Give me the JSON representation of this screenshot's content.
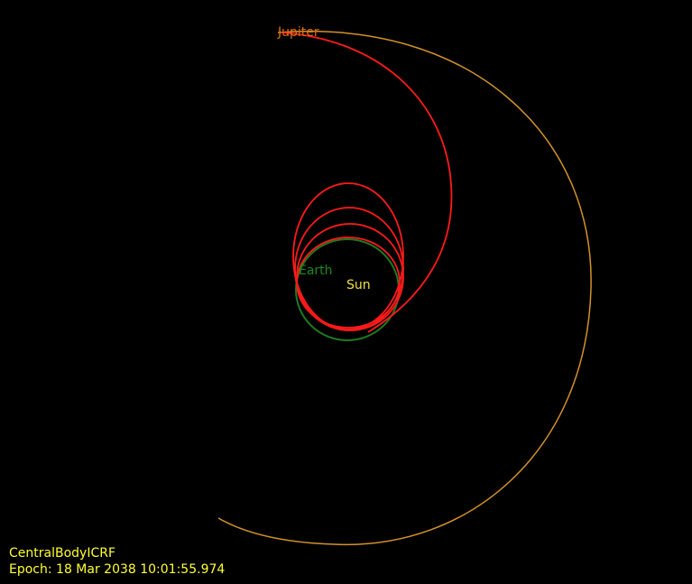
{
  "scene": {
    "background": "#000000",
    "bodies": {
      "jupiter": {
        "label": "Jupiter",
        "color": "#e07010"
      },
      "earth": {
        "label": "Earth",
        "color": "#1a8a1a"
      },
      "sun": {
        "label": "Sun",
        "color": "#f0e040"
      }
    },
    "orbits": {
      "jupiter_color": "#d4922a",
      "earth_color": "#1f7a1f",
      "spacecraft_color": "#ff1a1a"
    }
  },
  "overlay": {
    "frame": "CentralBodyICRF",
    "epoch": "Epoch: 18 Mar 2038 10:01:55.974",
    "color": "#ffff33"
  }
}
